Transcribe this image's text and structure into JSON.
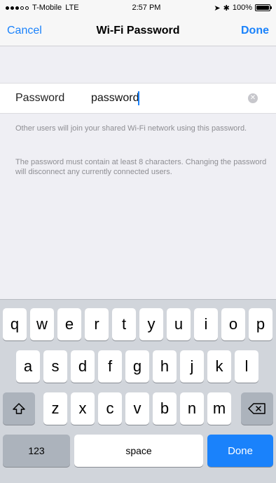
{
  "status_bar": {
    "carrier": "T-Mobile",
    "network": "LTE",
    "time": "2:57 PM",
    "battery": "100%"
  },
  "nav": {
    "cancel_label": "Cancel",
    "title": "Wi-Fi Password",
    "done_label": "Done"
  },
  "password_field": {
    "label": "Password",
    "value": "password"
  },
  "footer": {
    "text1": "Other users will join your shared Wi-Fi network using this password.",
    "text2": "The password must contain at least 8 characters. Changing the password will disconnect any currently connected users."
  },
  "keyboard": {
    "row1": [
      "q",
      "w",
      "e",
      "r",
      "t",
      "y",
      "u",
      "i",
      "o",
      "p"
    ],
    "row2": [
      "a",
      "s",
      "d",
      "f",
      "g",
      "h",
      "j",
      "k",
      "l"
    ],
    "row3": [
      "z",
      "x",
      "c",
      "v",
      "b",
      "n",
      "m"
    ],
    "numbers_label": "123",
    "space_label": "space",
    "done_label": "Done"
  },
  "colors": {
    "accent": "#1a82fb",
    "background": "#efeff4",
    "keyboard_bg": "#d1d5db"
  },
  "icons": {
    "shift": "shift-icon",
    "backspace": "backspace-icon",
    "clear": "clear-icon"
  }
}
